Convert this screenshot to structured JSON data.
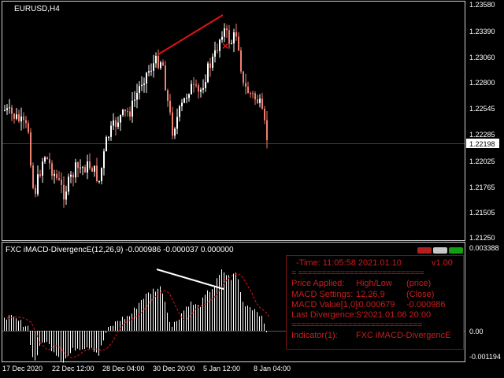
{
  "chart_data": [
    {
      "type": "candlestick",
      "title": "EURUSD,H4",
      "ylim": [
        1.2125,
        1.2365
      ],
      "y_ticks": [
        "1.23580",
        "1.23390",
        "1.23060",
        "1.22800",
        "1.22545",
        "1.22285",
        "1.22025",
        "1.21765",
        "1.21505",
        "1.21250"
      ],
      "current_price": "1.22198",
      "divergence_line": {
        "from_price": 1.231,
        "to_price": 1.2355
      },
      "marker": "×"
    },
    {
      "type": "bar",
      "title": "FXC iMACD-DivergencE(12,26,9) -0.000986 -0.000037 0.000000",
      "y_ticks": [
        "0.003388",
        "0.00",
        "-0.001194"
      ],
      "ylim": [
        -0.001194,
        0.003388
      ],
      "divergence_line": {
        "from_value": 0.00265,
        "to_value": 0.00175
      }
    }
  ],
  "x_ticks": [
    "17 Dec 2020",
    "22 Dec 12:00",
    "28 Dec 04:00",
    "30 Dec 20:00",
    "5 Jan 12:00",
    "8 Jan 04:00"
  ],
  "colors": {
    "bull": "#ffffff",
    "bear": "#f08070",
    "divergence": "#e01414",
    "signal": "#e01414",
    "grid": "#1a5a1a"
  },
  "info": {
    "time_label": "-Time: 11:05:58 2021.01.10",
    "version": "v1.00",
    "sep1": "= ===========================",
    "price_key": "Price Applied:",
    "price_v1": "High/Low",
    "price_v2": "(price)",
    "macd_key": "MACD Settings:",
    "macd_v1": "12,26,9",
    "macd_v2": "(Close)",
    "value_key": "MACD Value[1,0]:",
    "value_v1": "-0.000679",
    "value_v2": "-0.000986",
    "div_key": "Last Divergence:",
    "div_v1": "S'2021.01.06 20:00",
    "sep2": "============================",
    "ind_key": "Indicator(1):",
    "ind_v1": "FXC iMACD-DivergencE"
  }
}
